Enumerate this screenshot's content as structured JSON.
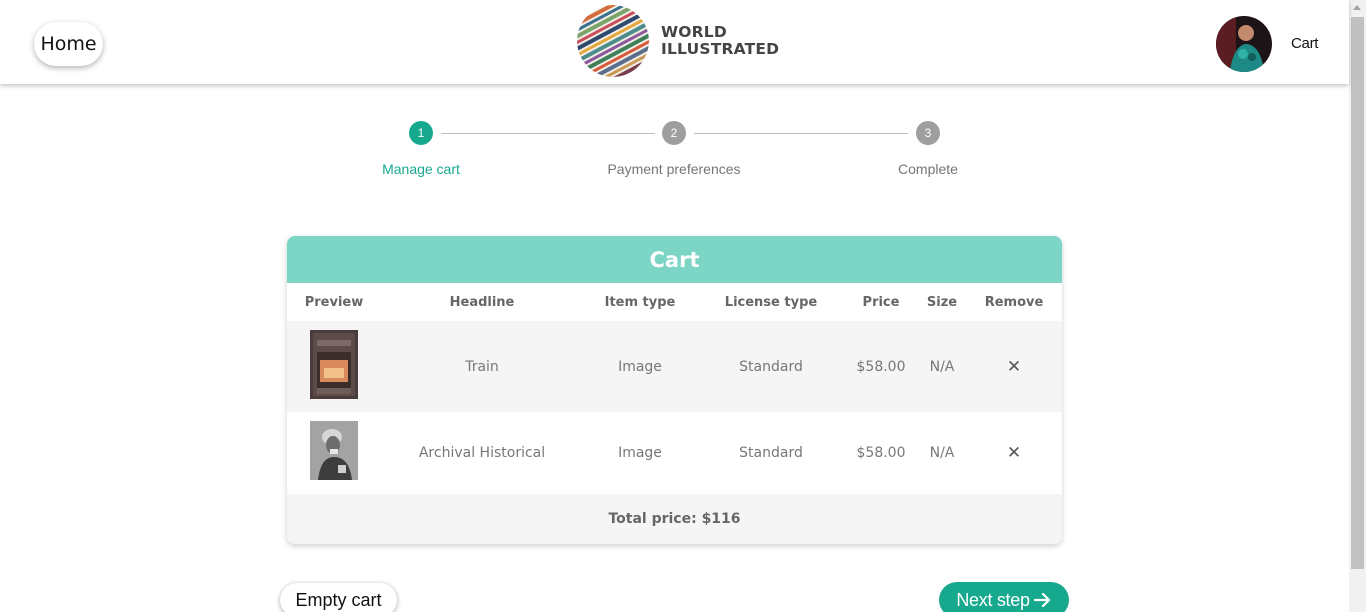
{
  "header": {
    "home_label": "Home",
    "logo_line1": "WORLD",
    "logo_line2": "ILLUSTRATED",
    "cart_label": "Cart"
  },
  "stepper": {
    "steps": [
      {
        "number": "1",
        "label": "Manage cart",
        "active": true
      },
      {
        "number": "2",
        "label": "Payment preferences",
        "active": false
      },
      {
        "number": "3",
        "label": "Complete",
        "active": false
      }
    ]
  },
  "cart": {
    "title": "Cart",
    "columns": [
      "Preview",
      "Headline",
      "Item type",
      "License type",
      "Price",
      "Size",
      "Remove"
    ],
    "rows": [
      {
        "headline": "Train",
        "item_type": "Image",
        "license_type": "Standard",
        "price": "$58.00",
        "size": "N/A",
        "remove_icon": "close-icon"
      },
      {
        "headline": "Archival Historical",
        "item_type": "Image",
        "license_type": "Standard",
        "price": "$58.00",
        "size": "N/A",
        "remove_icon": "close-icon"
      }
    ],
    "total": "Total price: $116"
  },
  "actions": {
    "empty_label": "Empty cart",
    "next_label": "Next step"
  },
  "colors": {
    "accent": "#17a98e",
    "cart_header": "#7dd5c5",
    "inactive_step": "#9e9e9e"
  }
}
